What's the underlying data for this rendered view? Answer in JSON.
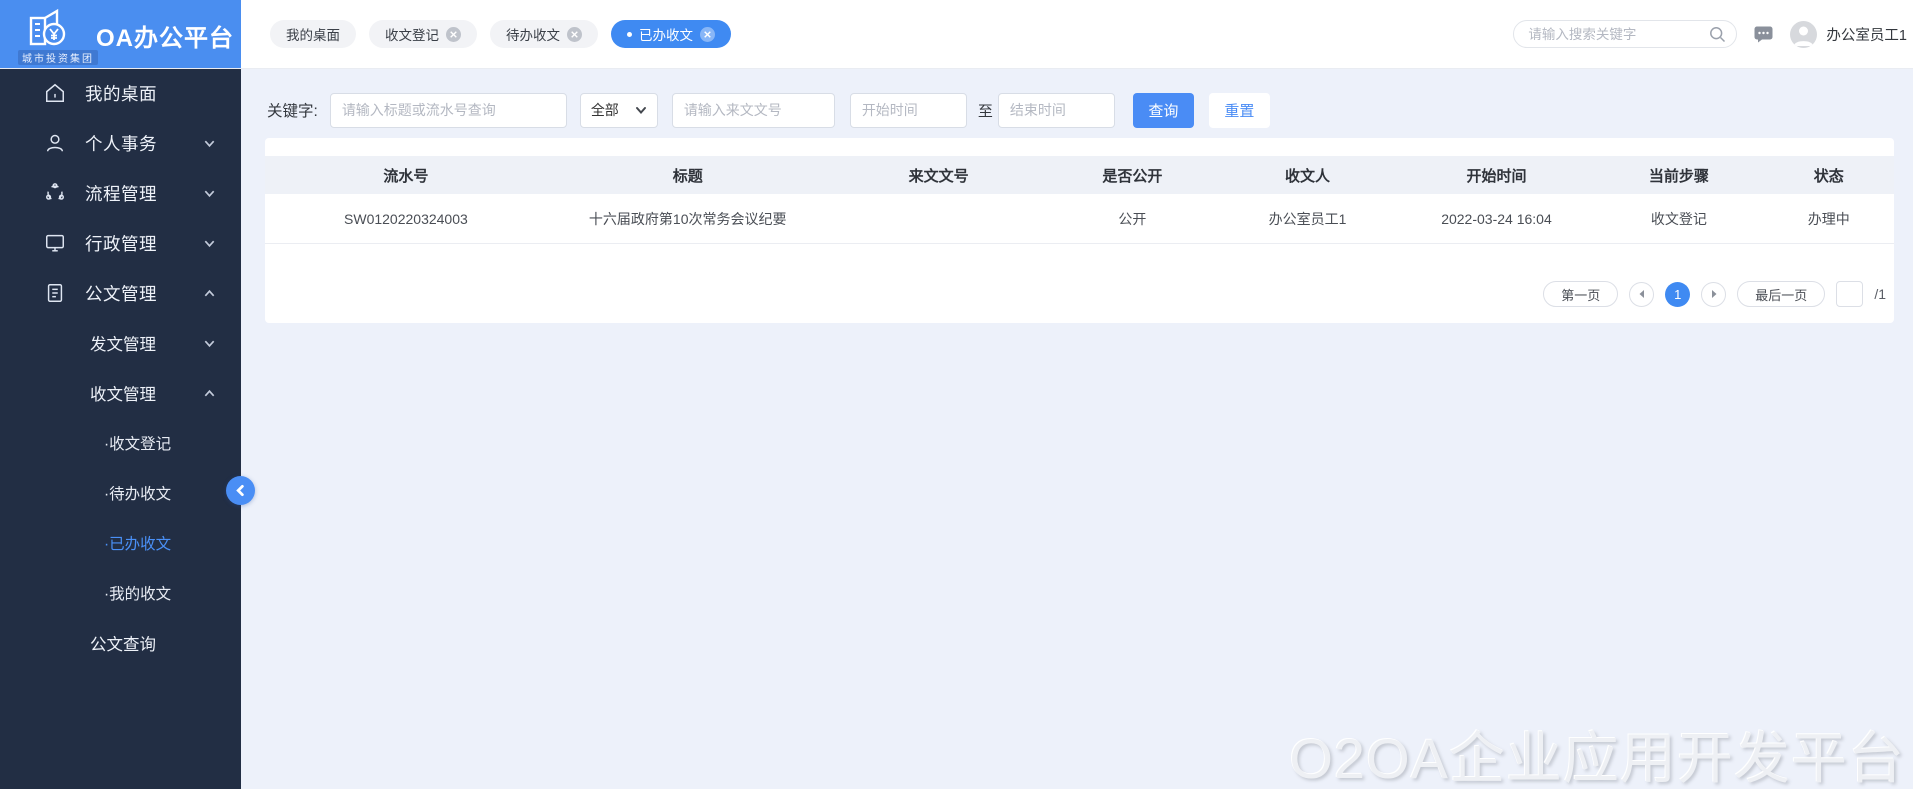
{
  "brand": {
    "title": "OA办公平台",
    "subtitle": "城市投资集团"
  },
  "tabs": [
    {
      "label": "我的桌面",
      "closable": false,
      "active": false
    },
    {
      "label": "收文登记",
      "closable": true,
      "active": false
    },
    {
      "label": "待办收文",
      "closable": true,
      "active": false
    },
    {
      "label": "已办收文",
      "closable": true,
      "active": true
    }
  ],
  "topbar": {
    "search_placeholder": "请输入搜索关键字",
    "username": "办公室员工1"
  },
  "sidebar": {
    "items": [
      {
        "label": "我的桌面",
        "level": 1,
        "icon": "home-icon"
      },
      {
        "label": "个人事务",
        "level": 1,
        "icon": "user-icon",
        "chevron": "down"
      },
      {
        "label": "流程管理",
        "level": 1,
        "icon": "process-icon",
        "chevron": "down"
      },
      {
        "label": "行政管理",
        "level": 1,
        "icon": "monitor-icon",
        "chevron": "down"
      },
      {
        "label": "公文管理",
        "level": 1,
        "icon": "document-icon",
        "chevron": "up"
      },
      {
        "label": "发文管理",
        "level": 2,
        "chevron": "down"
      },
      {
        "label": "收文管理",
        "level": 2,
        "chevron": "up"
      },
      {
        "label": "·收文登记",
        "level": 3,
        "active": false
      },
      {
        "label": "·待办收文",
        "level": 3,
        "active": false
      },
      {
        "label": "·已办收文",
        "level": 3,
        "active": true
      },
      {
        "label": "·我的收文",
        "level": 3,
        "active": false
      },
      {
        "label": "公文查询",
        "level": 2
      }
    ]
  },
  "filter": {
    "label": "关键字:",
    "keyword_placeholder": "请输入标题或流水号查询",
    "category_value": "全部",
    "docno_placeholder": "请输入来文文号",
    "start_placeholder": "开始时间",
    "range_separator": "至",
    "end_placeholder": "结束时间",
    "query_label": "查询",
    "reset_label": "重置"
  },
  "table": {
    "columns": [
      "流水号",
      "标题",
      "来文文号",
      "是否公开",
      "收文人",
      "开始时间",
      "当前步骤",
      "状态"
    ],
    "rows": [
      {
        "serial": "SW0120220324003",
        "title": "十六届政府第10次常务会议纪要",
        "doc_no": "",
        "is_public": "公开",
        "receiver": "办公室员工1",
        "start_time": "2022-03-24 16:04",
        "current_step": "收文登记",
        "status": "办理中"
      }
    ]
  },
  "pagination": {
    "first_label": "第一页",
    "last_label": "最后一页",
    "current_page": "1",
    "total_suffix": "/1",
    "jump_value": ""
  },
  "watermark": "O2OA企业应用开发平台",
  "colors": {
    "brand_blue": "#4a8ef0",
    "active_blue": "#3f8af2",
    "sidebar_bg": "#222e44",
    "page_bg": "#edf1fa",
    "table_header_bg": "#eef1f7",
    "active_text": "#4a90f7"
  }
}
